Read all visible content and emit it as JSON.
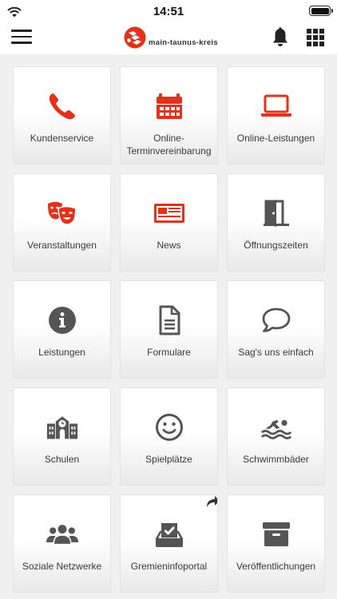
{
  "status": {
    "time": "14:51"
  },
  "header": {
    "logo_text": "main-taunus-kreis"
  },
  "colors": {
    "accent": "#e2321b",
    "icon_gray": "#555555"
  },
  "tiles": [
    {
      "label": "Kundenservice",
      "icon": "phone-icon"
    },
    {
      "label": "Online-\nTerminvereinbarung",
      "icon": "calendar-icon"
    },
    {
      "label": "Online-Leistungen",
      "icon": "laptop-icon"
    },
    {
      "label": "Veranstaltungen",
      "icon": "theater-masks-icon"
    },
    {
      "label": "News",
      "icon": "newspaper-icon"
    },
    {
      "label": "Öffnungszeiten",
      "icon": "door-icon"
    },
    {
      "label": "Leistungen",
      "icon": "info-icon"
    },
    {
      "label": "Formulare",
      "icon": "document-icon"
    },
    {
      "label": "Sag's uns einfach",
      "icon": "speech-bubble-icon"
    },
    {
      "label": "Schulen",
      "icon": "school-icon"
    },
    {
      "label": "Spielplätze",
      "icon": "smiley-icon"
    },
    {
      "label": "Schwimmbäder",
      "icon": "swimmer-icon"
    },
    {
      "label": "Soziale Netzwerke",
      "icon": "users-icon"
    },
    {
      "label": "Gremieninfoportal",
      "icon": "ballot-box-icon",
      "external": true
    },
    {
      "label": "Veröffentlichungen",
      "icon": "archive-box-icon"
    }
  ]
}
